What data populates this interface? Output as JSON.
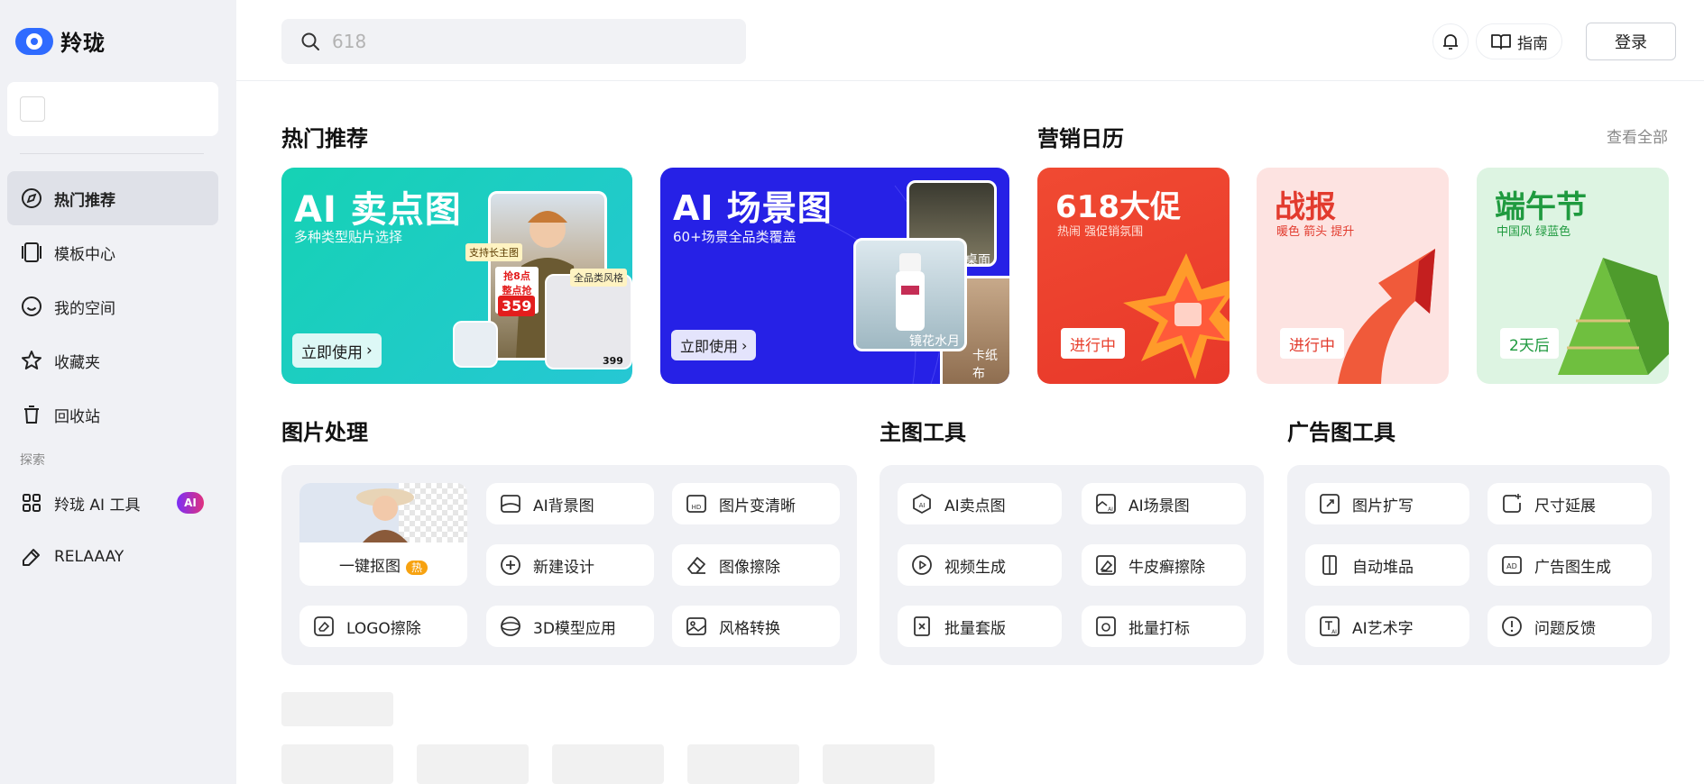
{
  "app": {
    "name": "羚珑"
  },
  "search": {
    "placeholder": "618"
  },
  "header": {
    "guide_label": "指南",
    "login_label": "登录"
  },
  "sidebar": {
    "items": [
      {
        "label": "热门推荐",
        "icon": "compass-icon",
        "active": true
      },
      {
        "label": "模板中心",
        "icon": "template-icon"
      },
      {
        "label": "我的空间",
        "icon": "smile-icon"
      },
      {
        "label": "收藏夹",
        "icon": "star-icon"
      },
      {
        "label": "回收站",
        "icon": "trash-icon"
      }
    ],
    "section_label": "探索",
    "explore": [
      {
        "label": "羚珑 AI 工具",
        "icon": "grid-icon",
        "badge": "AI"
      },
      {
        "label": "RELAAAY",
        "icon": "relay-icon"
      }
    ]
  },
  "sections": {
    "hot": "热门推荐",
    "calendar": "营销日历",
    "see_all": "查看全部",
    "image_processing": "图片处理",
    "main_tools": "主图工具",
    "ad_tools": "广告图工具"
  },
  "banners": [
    {
      "title": "AI 卖点图",
      "subtitle": "多种类型贴片选择",
      "button": "立即使用",
      "tags": [
        "支持长主图",
        "抢8点整点抢购",
        "359",
        "全品类风格",
        "399"
      ]
    },
    {
      "title": "AI 场景图",
      "subtitle": "60+场景全品类覆盖",
      "button": "立即使用",
      "tags": [
        "桌面",
        "镜花水月",
        "卡纸布"
      ]
    }
  ],
  "calendar": [
    {
      "title": "618大促",
      "subtitle": "热闹 强促销氛围",
      "status": "进行中",
      "color": "#e8402d"
    },
    {
      "title": "战报",
      "subtitle": "暖色 箭头 提升",
      "status": "进行中",
      "color": "#e23b2e"
    },
    {
      "title": "端午节",
      "subtitle": "中国风 绿蓝色",
      "status": "2天后",
      "color": "#1f9a3f"
    }
  ],
  "tools": {
    "image_processing": {
      "cutout": {
        "label": "一键抠图",
        "badge": "热"
      },
      "items": [
        "AI背景图",
        "图片变清晰",
        "新建设计",
        "图像擦除",
        "LOGO擦除",
        "3D模型应用",
        "风格转换"
      ]
    },
    "main": [
      "AI卖点图",
      "AI场景图",
      "视频生成",
      "牛皮癣擦除",
      "批量套版",
      "批量打标"
    ],
    "ad": [
      "图片扩写",
      "尺寸延展",
      "自动堆品",
      "广告图生成",
      "AI艺术字",
      "问题反馈"
    ]
  }
}
